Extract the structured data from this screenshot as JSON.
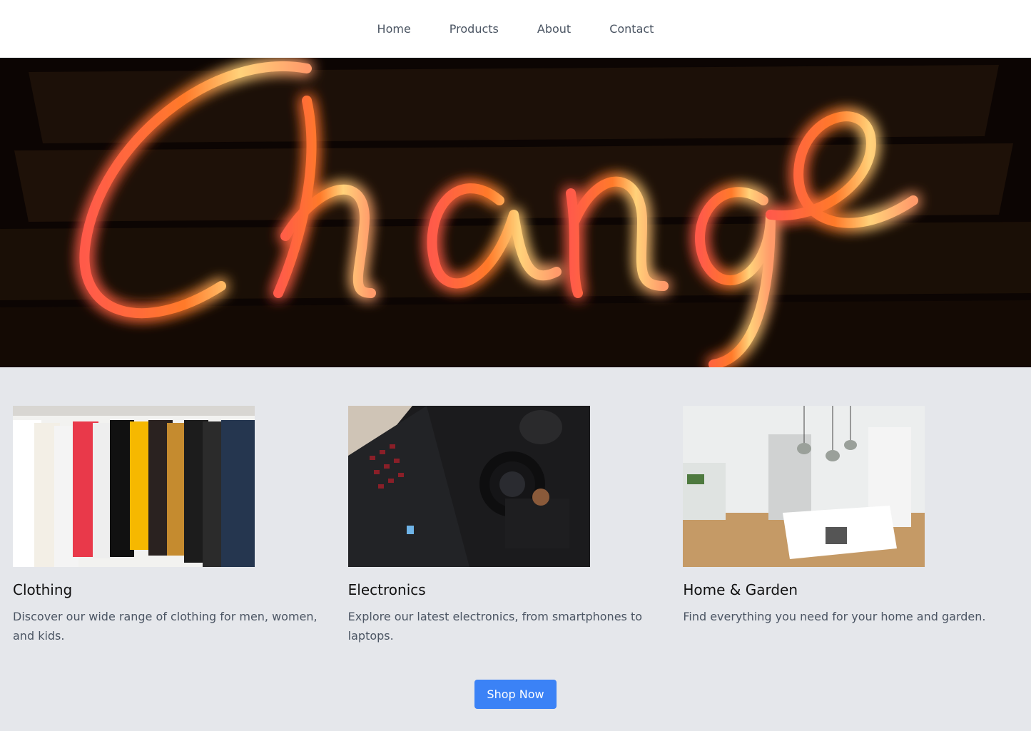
{
  "nav": {
    "items": [
      {
        "label": "Home"
      },
      {
        "label": "Products"
      },
      {
        "label": "About"
      },
      {
        "label": "Contact"
      }
    ]
  },
  "hero": {
    "neon_text": "Change"
  },
  "categories": [
    {
      "title": "Clothing",
      "description": "Discover our wide range of clothing for men, women, and kids."
    },
    {
      "title": "Electronics",
      "description": "Explore our latest electronics, from smartphones to laptops."
    },
    {
      "title": "Home & Garden",
      "description": "Find everything you need for your home and garden."
    }
  ],
  "cta": {
    "label": "Shop Now"
  },
  "colors": {
    "accent": "#3b82f6",
    "background": "#e5e7eb",
    "nav_background": "#ffffff"
  }
}
